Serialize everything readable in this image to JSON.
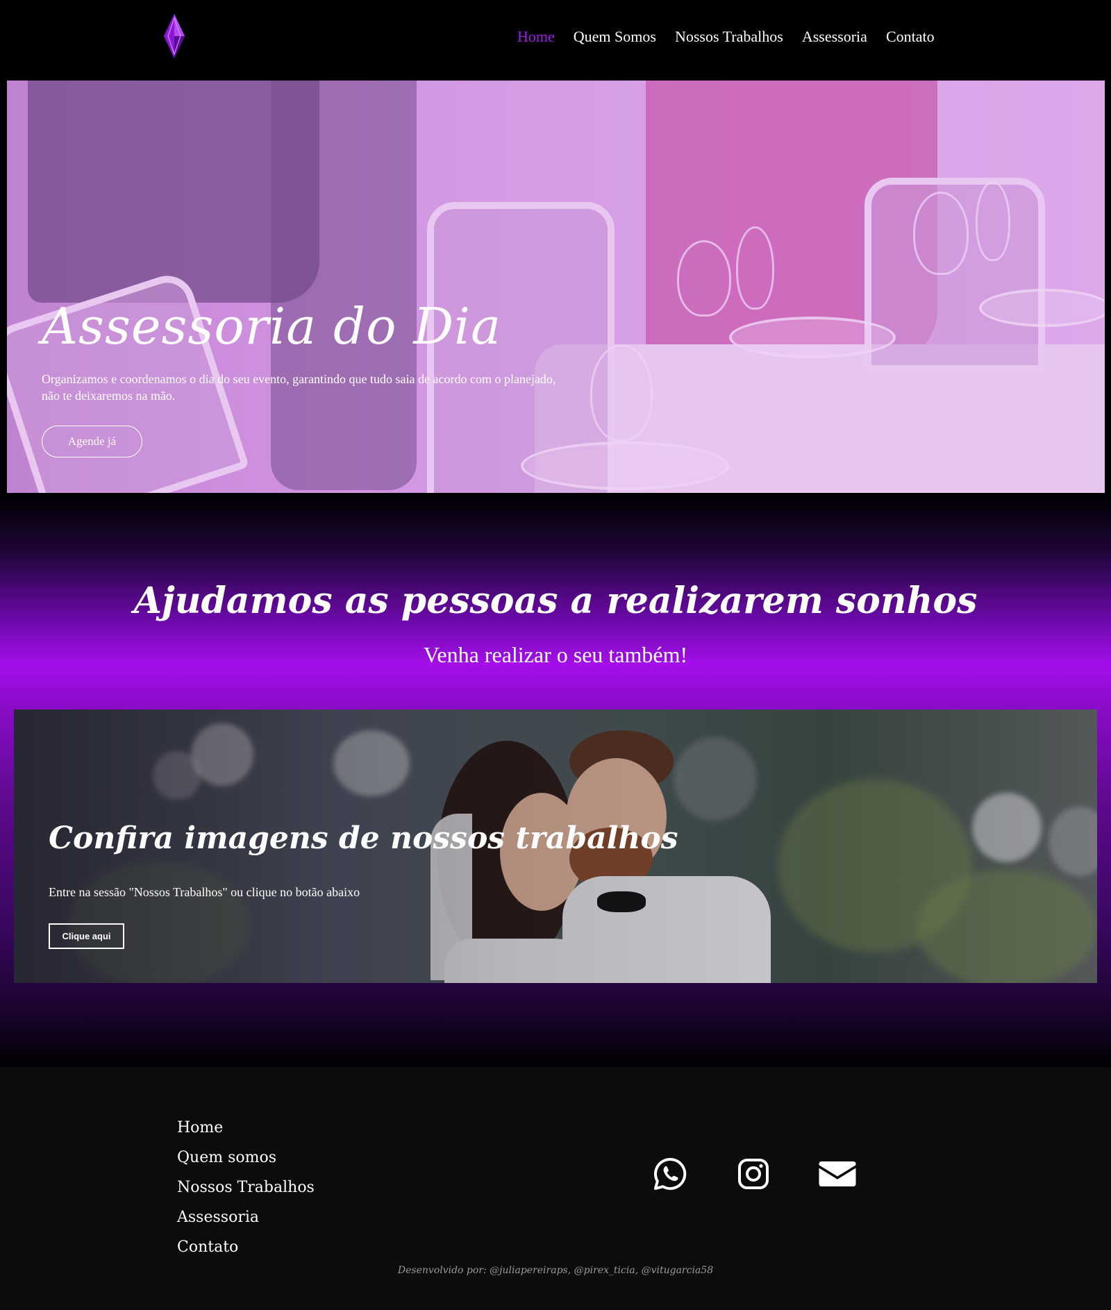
{
  "nav": {
    "logo": "diamond-logo",
    "items": [
      {
        "label": "Home",
        "active": true
      },
      {
        "label": "Quem Somos",
        "active": false
      },
      {
        "label": "Nossos Trabalhos",
        "active": false
      },
      {
        "label": "Assessoria",
        "active": false
      },
      {
        "label": "Contato",
        "active": false
      }
    ]
  },
  "hero": {
    "title": "Assessoria do Dia",
    "text": "Organizamos e coordenamos o dia do seu evento, garantindo que tudo saia de acordo com o planejado, não te deixaremos na mão.",
    "button": "Agende já"
  },
  "dreams": {
    "title": "Ajudamos as pessoas a realizarem sonhos",
    "subtitle": "Venha realizar o seu também!"
  },
  "works": {
    "title": "Confira imagens de nossos trabalhos",
    "text": "Entre na sessão \"Nossos Trabalhos\" ou clique no botão abaixo",
    "button": "Clique aqui"
  },
  "footer": {
    "links": [
      "Home",
      "Quem somos",
      "Nossos Trabalhos",
      "Assessoria",
      "Contato"
    ],
    "social": [
      "whatsapp-icon",
      "instagram-icon",
      "email-icon"
    ],
    "credits": "Desenvolvido por: @juliapereiraps, @pirex_ticia, @vitugarcia58"
  },
  "colors": {
    "accent": "#9b1ee8",
    "nav_bg": "#000000",
    "footer_bg": "#0c0c0c"
  }
}
